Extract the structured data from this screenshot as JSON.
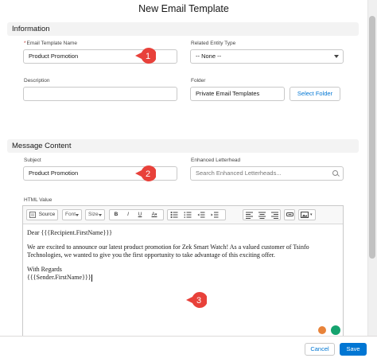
{
  "modal": {
    "title": "New Email Template"
  },
  "information": {
    "header": "Information",
    "email_template_name": {
      "label": "Email Template Name",
      "value": "Product Promotion"
    },
    "related_entity_type": {
      "label": "Related Entity Type",
      "value": "-- None --"
    },
    "description": {
      "label": "Description",
      "value": ""
    },
    "folder": {
      "label": "Folder",
      "value": "Private Email Templates",
      "button": "Select Folder"
    }
  },
  "message_content": {
    "header": "Message Content",
    "subject": {
      "label": "Subject",
      "value": "Product Promotion"
    },
    "enhanced_letterhead": {
      "label": "Enhanced Letterhead",
      "placeholder": "Search Enhanced Letterheads..."
    },
    "html_value": {
      "label": "HTML Value"
    }
  },
  "toolbar": {
    "source": "Source",
    "font": "Font",
    "size": "Size",
    "bold": "B",
    "italic": "I",
    "underline": "U",
    "color": "A"
  },
  "editor": {
    "greeting": "Dear {{{Recipient.FirstName}}}",
    "body": "We are excited to announce our latest product promotion for Zek Smart Watch! As a valued customer of Tsinfo Technologies, we wanted to give you the first opportunity to take advantage of this exciting offer.",
    "closing": "With Regards",
    "signature": "{{{Sender.FirstName}}}"
  },
  "markers": [
    "1",
    "2",
    "3"
  ],
  "footer": {
    "cancel": "Cancel",
    "save": "Save"
  },
  "colors": {
    "accent": "#0176d3",
    "marker": "#e8413a",
    "required": "#c23934"
  }
}
